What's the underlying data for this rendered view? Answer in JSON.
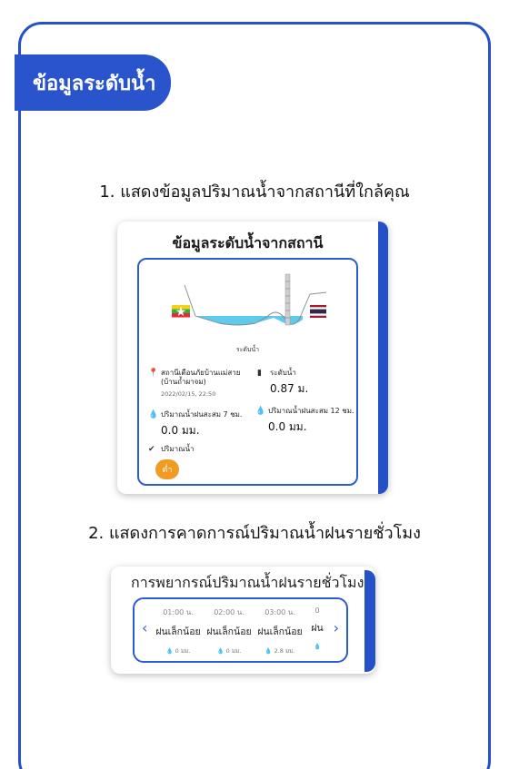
{
  "header": {
    "title": "ข้อมูลระดับน้ำ"
  },
  "captions": {
    "first": "1. แสดงข้อมูลปริมาณน้ำจากสถานีที่ใกล้คุณ",
    "second": "2. แสดงการคาดการณ์ปริมาณน้ำฝนรายชั่วโมง"
  },
  "station_card": {
    "title": "ข้อมูลระดับน้ำจากสถานี",
    "river_label": "ระดับน้ำ",
    "station_name": "สถานีเตือนภัยบ้านแม่สาย",
    "station_name_line2": "(บ้านถ้ำผาจม)",
    "timestamp": "2022/02/15, 22:50",
    "water_level_label": "ระดับน้ำ",
    "water_level_value": "0.87 ม.",
    "rain7_label": "ปริมาณน้ำฝนสะสม 7 ชม.",
    "rain7_value": "0.0 มม.",
    "rain12_label": "ปริมาณน้ำฝนสะสม 12 ชม.",
    "rain12_value": "0.0 มม.",
    "volume_label": "ปริมาณน้ำ",
    "volume_status": "ต่ำ",
    "colors": {
      "water": "#5ecbed",
      "accent": "#2450c8",
      "status": "#f29b22"
    }
  },
  "forecast_card": {
    "title": "การพยากรณ์ปริมาณน้ำฝนรายชั่วโมง",
    "prev_icon": "chevron-left-icon",
    "next_icon": "chevron-right-icon",
    "hours": [
      {
        "time": "01:00 น.",
        "desc": "ฝนเล็กน้อย",
        "rain": "0 มม."
      },
      {
        "time": "02:00 น.",
        "desc": "ฝนเล็กน้อย",
        "rain": "0 มม."
      },
      {
        "time": "03:00 น.",
        "desc": "ฝนเล็กน้อย",
        "rain": "2.8 มม."
      },
      {
        "time": "0",
        "desc": "ฝน",
        "rain": ""
      }
    ]
  }
}
